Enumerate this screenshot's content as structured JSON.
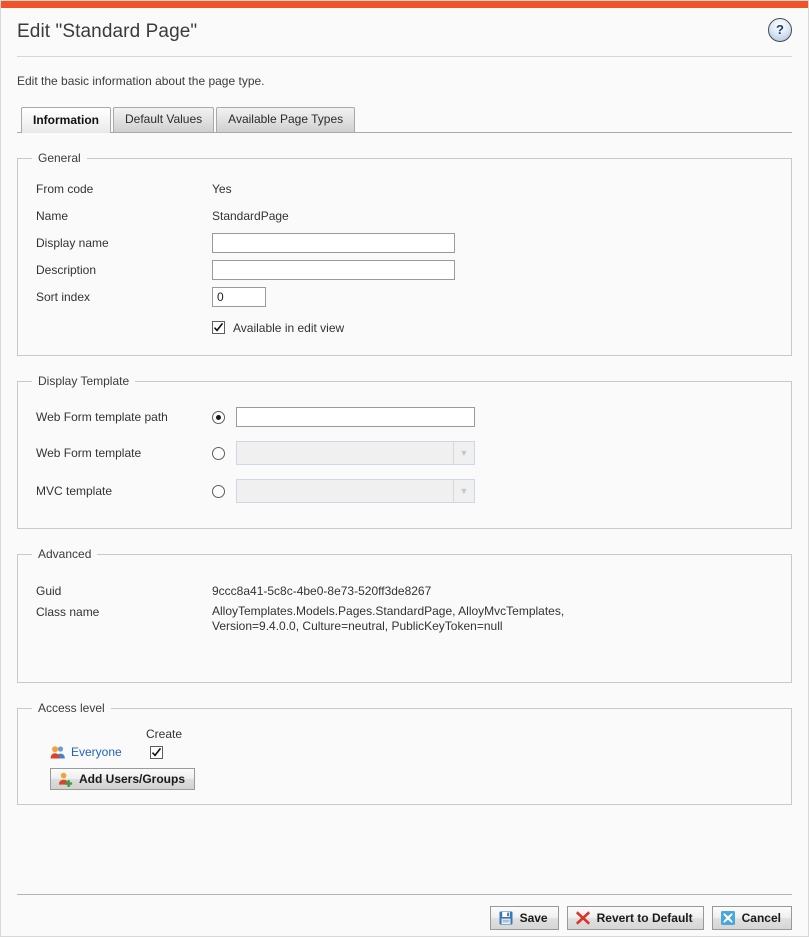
{
  "theme": {
    "accent_bar_color": "#f25227",
    "link_color": "#2563b8",
    "page_background": "#fafafa"
  },
  "header": {
    "title": "Edit \"Standard Page\"",
    "help_icon": "question-mark-icon",
    "help_label": "?"
  },
  "intro": {
    "text": "Edit the basic information about the page type."
  },
  "tabs": [
    {
      "label": "Information",
      "active": true
    },
    {
      "label": "Default Values",
      "active": false
    },
    {
      "label": "Available Page Types",
      "active": false
    }
  ],
  "general": {
    "legend": "General",
    "from_code_label": "From code",
    "from_code_value": "Yes",
    "name_label": "Name",
    "name_value": "StandardPage",
    "display_name_label": "Display name",
    "display_name_value": "",
    "display_name_placeholder": "",
    "description_label": "Description",
    "description_value": "",
    "description_placeholder": "",
    "sort_index_label": "Sort index",
    "sort_index_value": "0",
    "available_in_edit_view_label": "Available in edit view",
    "available_in_edit_view_checked": true
  },
  "display_template": {
    "legend": "Display Template",
    "web_form_template_path_label": "Web Form template path",
    "web_form_template_path_value": "",
    "web_form_template_path_selected": true,
    "web_form_template_label": "Web Form template",
    "web_form_template_value": "",
    "web_form_template_selected": false,
    "web_form_template_disabled": true,
    "mvc_template_label": "MVC template",
    "mvc_template_value": "",
    "mvc_template_selected": false,
    "mvc_template_disabled": true,
    "dropdown_arrow_icon": "chevron-down-icon"
  },
  "advanced": {
    "legend": "Advanced",
    "guid_label": "Guid",
    "guid_value": "9ccc8a41-5c8c-4be0-8e73-520ff3de8267",
    "class_name_label": "Class name",
    "class_name_value": "AlloyTemplates.Models.Pages.StandardPage, AlloyMvcTemplates, Version=9.4.0.0, Culture=neutral, PublicKeyToken=null"
  },
  "access_level": {
    "legend": "Access level",
    "create_column_header": "Create",
    "rows": [
      {
        "name": "Everyone",
        "icon": "users-group-icon",
        "create_checked": true
      }
    ],
    "add_button_label": "Add Users/Groups",
    "add_button_icon": "add-user-icon"
  },
  "footer": {
    "buttons": [
      {
        "label": "Save",
        "icon": "save-floppy-icon"
      },
      {
        "label": "Revert to Default",
        "icon": "red-x-icon"
      },
      {
        "label": "Cancel",
        "icon": "blue-x-icon"
      }
    ]
  }
}
